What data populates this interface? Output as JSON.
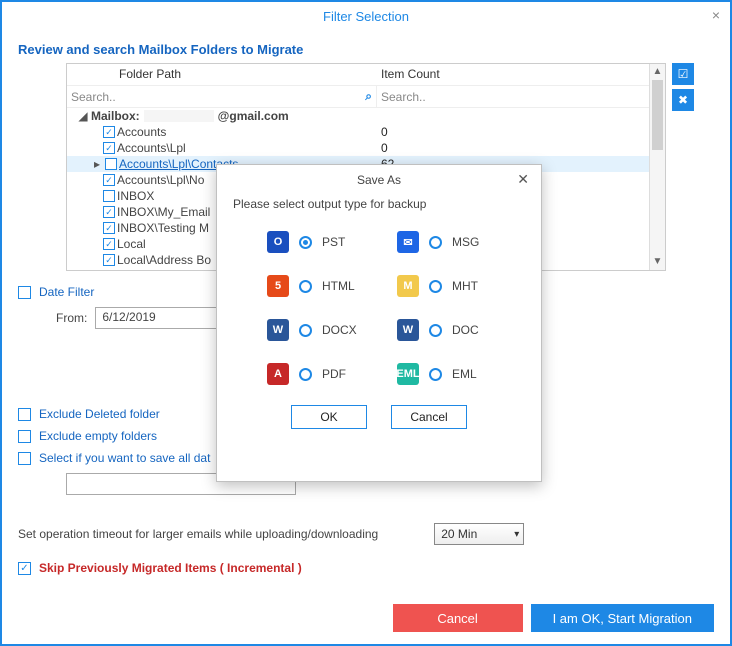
{
  "window": {
    "title": "Filter Selection"
  },
  "section_heading": "Review and search Mailbox Folders to Migrate",
  "headers": {
    "path": "Folder Path",
    "count": "Item Count"
  },
  "search_placeholder": "Search..",
  "mailbox_label": "Mailbox:",
  "mailbox_email_suffix": "@gmail.com",
  "rows": [
    {
      "name": "Accounts",
      "count": "0",
      "checked": true
    },
    {
      "name": "Accounts\\Lpl",
      "count": "0",
      "checked": true
    },
    {
      "name": "Accounts\\Lpl\\Contacts",
      "count": "62",
      "checked": false,
      "selected": true
    },
    {
      "name": "Accounts\\Lpl\\No",
      "count": "",
      "checked": true
    },
    {
      "name": "INBOX",
      "count": "",
      "checked": false
    },
    {
      "name": "INBOX\\My_Email",
      "count": "",
      "checked": true
    },
    {
      "name": "INBOX\\Testing M",
      "count": "",
      "checked": true
    },
    {
      "name": "Local",
      "count": "",
      "checked": true
    },
    {
      "name": "Local\\Address Bo",
      "count": "",
      "checked": true
    }
  ],
  "date_filter": {
    "label": "Date Filter",
    "from_label": "From:",
    "from_value": "6/12/2019"
  },
  "options": {
    "exclude_deleted": "Exclude Deleted folder",
    "exclude_empty": "Exclude empty folders",
    "save_all": "Select if you want to save all dat"
  },
  "timeout": {
    "label": "Set operation timeout for larger emails while uploading/downloading",
    "value": "20 Min"
  },
  "skip_label": "Skip Previously Migrated Items ( Incremental )",
  "footer": {
    "cancel": "Cancel",
    "ok": "I am OK, Start Migration"
  },
  "modal": {
    "title": "Save As",
    "desc": "Please select output type for backup",
    "formats": [
      {
        "name": "PST",
        "icon_bg": "#1a4fbf",
        "icon_txt": "O",
        "selected": true
      },
      {
        "name": "MSG",
        "icon_bg": "#1e66e5",
        "icon_txt": "✉",
        "selected": false
      },
      {
        "name": "HTML",
        "icon_bg": "#e64a19",
        "icon_txt": "5",
        "selected": false
      },
      {
        "name": "MHT",
        "icon_bg": "#f2c94c",
        "icon_txt": "M",
        "selected": false
      },
      {
        "name": "DOCX",
        "icon_bg": "#2a5699",
        "icon_txt": "W",
        "selected": false
      },
      {
        "name": "DOC",
        "icon_bg": "#2a5699",
        "icon_txt": "W",
        "selected": false
      },
      {
        "name": "PDF",
        "icon_bg": "#c62828",
        "icon_txt": "A",
        "selected": false
      },
      {
        "name": "EML",
        "icon_bg": "#1fb9a2",
        "icon_txt": "EML",
        "selected": false
      }
    ],
    "ok": "OK",
    "cancel": "Cancel"
  }
}
